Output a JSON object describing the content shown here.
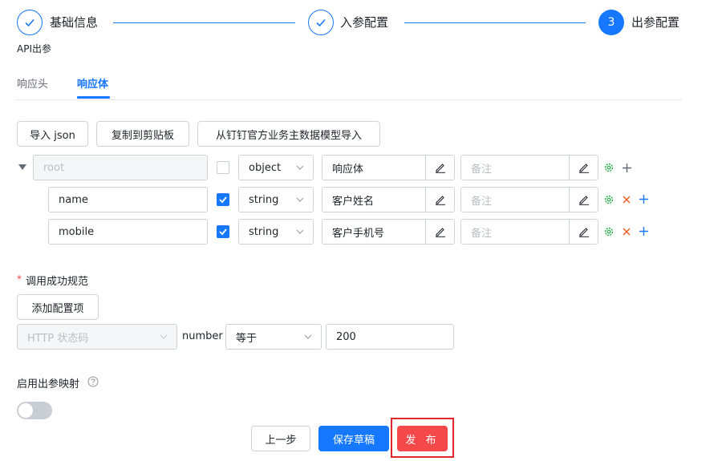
{
  "steps": [
    {
      "label": "基础信息",
      "state": "done"
    },
    {
      "label": "入参配置",
      "state": "done"
    },
    {
      "number": "3",
      "label": "出参配置",
      "state": "active"
    }
  ],
  "section_title": "API出参",
  "tabs": [
    {
      "label": "响应头",
      "active": false
    },
    {
      "label": "响应体",
      "active": true
    }
  ],
  "toolbar": {
    "import_json": "导入 json",
    "copy_clipboard": "复制到剪贴板",
    "import_dingtalk": "从钉钉官方业务主数据模型导入"
  },
  "params": [
    {
      "name": "root",
      "checked": false,
      "type": "object",
      "desc": "响应体",
      "remark_placeholder": "备注",
      "disabled": true
    },
    {
      "name": "name",
      "checked": true,
      "type": "string",
      "desc": "客户姓名",
      "remark_placeholder": "备注",
      "disabled": false
    },
    {
      "name": "mobile",
      "checked": true,
      "type": "string",
      "desc": "客户手机号",
      "remark_placeholder": "备注",
      "disabled": false
    }
  ],
  "success_spec": {
    "required_mark": "*",
    "label": "调用成功规范",
    "add_button": "添加配置项",
    "field_select": "HTTP 状态码",
    "type_label": "number",
    "operator": "等于",
    "value": "200"
  },
  "mapping": {
    "label": "启用出参映射",
    "enabled": false
  },
  "footer": {
    "prev": "上一步",
    "save_draft": "保存草稿",
    "publish": "发 布"
  },
  "colors": {
    "primary": "#1677ff",
    "danger": "#f5484a",
    "gear": "#2bac4b",
    "delete": "#f05b24",
    "highlight": "#e0262a"
  }
}
